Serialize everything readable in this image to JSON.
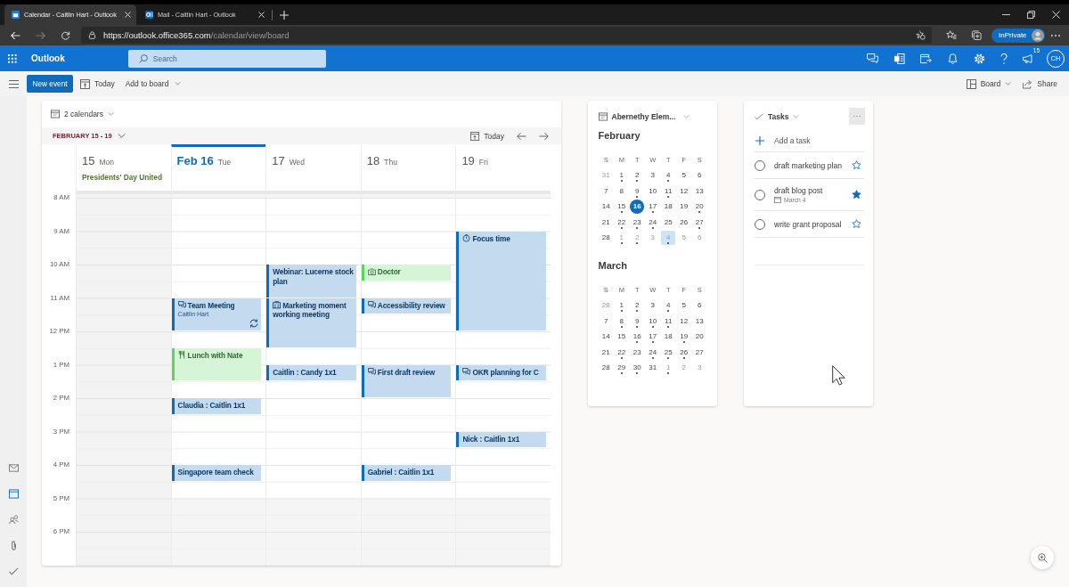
{
  "browser": {
    "tabs": [
      {
        "title": "Calendar - Caitlin Hart - Outlook",
        "selected": true
      },
      {
        "title": "Mail - Caitlin Hart - Outlook",
        "selected": false
      }
    ],
    "back_disabled": false,
    "forward_disabled": true,
    "address": {
      "url_main": "https://outlook.office365.com",
      "url_path": "/calendar/view/board"
    },
    "profile_label": "InPrivate"
  },
  "app_bar": {
    "app_name": "Outlook",
    "search": {
      "placeholder": "Search"
    },
    "notification_count": "15",
    "initials": "CH"
  },
  "command_bar": {
    "new_event": "New event",
    "today": "Today",
    "add_to_board": "Add to board",
    "view": "Board",
    "share": "Share"
  },
  "nav_rail": [
    {
      "selected": false
    },
    {
      "selected": true
    },
    {
      "selected": false
    },
    {
      "selected": false
    },
    {
      "selected": false
    }
  ],
  "calendar": {
    "calendars_label": "2 calendars",
    "date_range": "FEBRUARY 15 - 19",
    "today": "Today",
    "time_labels": [
      "8 AM",
      "9 AM",
      "10 AM",
      "11 AM",
      "12 PM",
      "1 PM",
      "2 PM",
      "3 PM",
      "4 PM",
      "5 PM",
      "6 PM"
    ],
    "days": [
      {
        "number": "15",
        "weekday": "Mon",
        "selected": false,
        "non_working": true,
        "all_day": "Presidents' Day United"
      },
      {
        "number": "Feb 16",
        "weekday": "Tue",
        "selected": true,
        "non_working": false,
        "slots": [
          {
            "kind": "free"
          },
          {
            "kind": "free"
          },
          {
            "kind": "free"
          },
          {
            "kind": "free"
          },
          {
            "kind": "free"
          },
          {
            "kind": "free"
          },
          {
            "kind": "event",
            "event": {
              "title": "Team Meeting",
              "detail": "Caitlin Hart",
              "color": "#0f6cbd",
              "kind": "online_meeting",
              "recurring": true
            }
          },
          {
            "kind": "continued"
          },
          {
            "kind": "free"
          },
          {
            "kind": "event",
            "event": {
              "title": "Lunch with Nate",
              "color": "#5ad65a",
              "kind": "meal",
              "recurring": false
            }
          },
          {
            "kind": "continued"
          },
          {
            "kind": "free"
          },
          {
            "kind": "event",
            "event": {
              "title": "Claudia : Caitlin 1x1",
              "color": "#0f6cbd",
              "kind": "plain",
              "recurring": false
            }
          },
          {
            "kind": "free"
          },
          {
            "kind": "free"
          },
          {
            "kind": "free"
          },
          {
            "kind": "event",
            "event": {
              "title": "Singapore team check",
              "color": "#0f6cbd",
              "kind": "plain",
              "recurring": false
            }
          }
        ]
      },
      {
        "number": "17",
        "weekday": "Wed",
        "selected": false,
        "non_working": false,
        "slots": [
          {
            "kind": "free"
          },
          {
            "kind": "free"
          },
          {
            "kind": "free"
          },
          {
            "kind": "free"
          },
          {
            "kind": "event",
            "event": {
              "title": "Webinar: Lucerne stock plan",
              "color": "#0f6cbd",
              "kind": "plain",
              "recurring": false
            }
          },
          {
            "kind": "continued"
          },
          {
            "kind": "event",
            "event": {
              "title": "Marketing moment working meeting",
              "color": "#0f6cbd",
              "kind": "room",
              "recurring": false
            }
          },
          {
            "kind": "continued"
          },
          {
            "kind": "continued"
          },
          {
            "kind": "free"
          },
          {
            "kind": "event",
            "event": {
              "title": "Caitlin : Candy 1x1",
              "color": "#0f6cbd",
              "kind": "plain",
              "recurring": false
            }
          }
        ]
      },
      {
        "number": "18",
        "weekday": "Thu",
        "selected": false,
        "non_working": false,
        "slots": [
          {
            "kind": "free"
          },
          {
            "kind": "free"
          },
          {
            "kind": "free"
          },
          {
            "kind": "free"
          },
          {
            "kind": "event",
            "event": {
              "title": "Doctor",
              "color": "#5ad65a",
              "kind": "appointment",
              "recurring": false
            }
          },
          {
            "kind": "free"
          },
          {
            "kind": "event",
            "event": {
              "title": "Accessibility review",
              "color": "#0f6cbd",
              "kind": "online_meeting",
              "recurring": false
            }
          },
          {
            "kind": "free"
          },
          {
            "kind": "free"
          },
          {
            "kind": "free"
          },
          {
            "kind": "event",
            "event": {
              "title": "First draft review",
              "color": "#0f6cbd",
              "kind": "online_meeting",
              "recurring": false
            }
          },
          {
            "kind": "continued"
          },
          {
            "kind": "free"
          },
          {
            "kind": "free"
          },
          {
            "kind": "free"
          },
          {
            "kind": "free"
          },
          {
            "kind": "event",
            "event": {
              "title": "Gabriel : Caitlin 1x1",
              "color": "#0f6cbd",
              "kind": "plain",
              "recurring": false
            }
          }
        ]
      },
      {
        "number": "19",
        "weekday": "Fri",
        "selected": false,
        "non_working": false,
        "slots": [
          {
            "kind": "free"
          },
          {
            "kind": "free"
          },
          {
            "kind": "event",
            "event": {
              "title": "Focus time",
              "color": "#0f6cbd",
              "kind": "focus",
              "recurring": false
            }
          },
          {
            "kind": "continued"
          },
          {
            "kind": "continued"
          },
          {
            "kind": "continued"
          },
          {
            "kind": "continued"
          },
          {
            "kind": "continued"
          },
          {
            "kind": "free"
          },
          {
            "kind": "free"
          },
          {
            "kind": "event",
            "event": {
              "title": "OKR planning for C",
              "color": "#0f6cbd",
              "kind": "online_meeting",
              "recurring": false
            }
          },
          {
            "kind": "free"
          },
          {
            "kind": "free"
          },
          {
            "kind": "free"
          },
          {
            "kind": "event",
            "event": {
              "title": "Nick : Caitlin 1x1",
              "color": "#0f6cbd",
              "kind": "plain",
              "recurring": false
            }
          }
        ]
      }
    ]
  },
  "mini_calendar": {
    "title": "Abernethy Elem...",
    "months": [
      {
        "name": "February",
        "weekdays": [
          "S",
          "M",
          "T",
          "W",
          "T",
          "F",
          "S"
        ],
        "weeks": [
          [
            {
              "label": "31",
              "outside_month": true,
              "events": false,
              "today": false,
              "selected": false
            },
            {
              "label": "1",
              "outside_month": false,
              "events": true,
              "today": false,
              "selected": false
            },
            {
              "label": "2",
              "outside_month": false,
              "events": true,
              "today": false,
              "selected": false
            },
            {
              "label": "3",
              "outside_month": false,
              "events": false,
              "today": false,
              "selected": false
            },
            {
              "label": "4",
              "outside_month": false,
              "events": true,
              "today": false,
              "selected": false
            },
            {
              "label": "5",
              "outside_month": false,
              "events": false,
              "today": false,
              "selected": false
            },
            {
              "label": "6",
              "outside_month": false,
              "events": false,
              "today": false,
              "selected": false
            }
          ],
          [
            {
              "label": "7",
              "outside_month": false,
              "events": false,
              "today": false,
              "selected": false
            },
            {
              "label": "8",
              "outside_month": false,
              "events": false,
              "today": false,
              "selected": false
            },
            {
              "label": "9",
              "outside_month": false,
              "events": true,
              "today": false,
              "selected": false
            },
            {
              "label": "10",
              "outside_month": false,
              "events": false,
              "today": false,
              "selected": false
            },
            {
              "label": "11",
              "outside_month": false,
              "events": true,
              "today": false,
              "selected": false
            },
            {
              "label": "12",
              "outside_month": false,
              "events": false,
              "today": false,
              "selected": false
            },
            {
              "label": "13",
              "outside_month": false,
              "events": false,
              "today": false,
              "selected": false
            }
          ],
          [
            {
              "label": "14",
              "outside_month": false,
              "events": false,
              "today": false,
              "selected": false
            },
            {
              "label": "15",
              "outside_month": false,
              "events": true,
              "today": false,
              "selected": false
            },
            {
              "label": "16",
              "outside_month": false,
              "events": false,
              "today": true,
              "selected": false
            },
            {
              "label": "17",
              "outside_month": false,
              "events": true,
              "today": false,
              "selected": false
            },
            {
              "label": "18",
              "outside_month": false,
              "events": false,
              "today": false,
              "selected": false
            },
            {
              "label": "19",
              "outside_month": false,
              "events": false,
              "today": false,
              "selected": false
            },
            {
              "label": "20",
              "outside_month": false,
              "events": true,
              "today": false,
              "selected": false
            }
          ],
          [
            {
              "label": "21",
              "outside_month": false,
              "events": false,
              "today": false,
              "selected": false
            },
            {
              "label": "22",
              "outside_month": false,
              "events": true,
              "today": false,
              "selected": false
            },
            {
              "label": "23",
              "outside_month": false,
              "events": true,
              "today": false,
              "selected": false
            },
            {
              "label": "24",
              "outside_month": false,
              "events": true,
              "today": false,
              "selected": false
            },
            {
              "label": "25",
              "outside_month": false,
              "events": false,
              "today": false,
              "selected": false
            },
            {
              "label": "26",
              "outside_month": false,
              "events": false,
              "today": false,
              "selected": false
            },
            {
              "label": "27",
              "outside_month": false,
              "events": true,
              "today": false,
              "selected": false
            }
          ],
          [
            {
              "label": "28",
              "outside_month": false,
              "events": false,
              "today": false,
              "selected": false
            },
            {
              "label": "1",
              "outside_month": true,
              "events": true,
              "today": false,
              "selected": false
            },
            {
              "label": "2",
              "outside_month": true,
              "events": true,
              "today": false,
              "selected": false
            },
            {
              "label": "3",
              "outside_month": true,
              "events": false,
              "today": false,
              "selected": false
            },
            {
              "label": "4",
              "outside_month": true,
              "events": true,
              "today": false,
              "selected": true
            },
            {
              "label": "5",
              "outside_month": true,
              "events": false,
              "today": false,
              "selected": false
            },
            {
              "label": "6",
              "outside_month": true,
              "events": false,
              "today": false,
              "selected": false
            }
          ]
        ]
      },
      {
        "name": "March",
        "weekdays": [
          "S",
          "M",
          "T",
          "W",
          "T",
          "F",
          "S"
        ],
        "weeks": [
          [
            {
              "label": "28",
              "outside_month": true,
              "events": false,
              "today": false,
              "selected": false
            },
            {
              "label": "1",
              "outside_month": false,
              "events": true,
              "today": false,
              "selected": false
            },
            {
              "label": "2",
              "outside_month": false,
              "events": true,
              "today": false,
              "selected": false
            },
            {
              "label": "3",
              "outside_month": false,
              "events": false,
              "today": false,
              "selected": false
            },
            {
              "label": "4",
              "outside_month": false,
              "events": true,
              "today": false,
              "selected": false
            },
            {
              "label": "5",
              "outside_month": false,
              "events": false,
              "today": false,
              "selected": false
            },
            {
              "label": "6",
              "outside_month": false,
              "events": false,
              "today": false,
              "selected": false
            }
          ],
          [
            {
              "label": "7",
              "outside_month": false,
              "events": false,
              "today": false,
              "selected": false
            },
            {
              "label": "8",
              "outside_month": false,
              "events": true,
              "today": false,
              "selected": false
            },
            {
              "label": "9",
              "outside_month": false,
              "events": true,
              "today": false,
              "selected": false
            },
            {
              "label": "10",
              "outside_month": false,
              "events": true,
              "today": false,
              "selected": false
            },
            {
              "label": "11",
              "outside_month": false,
              "events": true,
              "today": false,
              "selected": false
            },
            {
              "label": "12",
              "outside_month": false,
              "events": false,
              "today": false,
              "selected": false
            },
            {
              "label": "13",
              "outside_month": false,
              "events": false,
              "today": false,
              "selected": false
            }
          ],
          [
            {
              "label": "14",
              "outside_month": false,
              "events": false,
              "today": false,
              "selected": false
            },
            {
              "label": "15",
              "outside_month": false,
              "events": false,
              "today": false,
              "selected": false
            },
            {
              "label": "16",
              "outside_month": false,
              "events": true,
              "today": false,
              "selected": false
            },
            {
              "label": "17",
              "outside_month": false,
              "events": true,
              "today": false,
              "selected": false
            },
            {
              "label": "18",
              "outside_month": false,
              "events": false,
              "today": false,
              "selected": false
            },
            {
              "label": "19",
              "outside_month": false,
              "events": true,
              "today": false,
              "selected": false
            },
            {
              "label": "20",
              "outside_month": false,
              "events": false,
              "today": false,
              "selected": false
            }
          ],
          [
            {
              "label": "21",
              "outside_month": false,
              "events": false,
              "today": false,
              "selected": false
            },
            {
              "label": "22",
              "outside_month": false,
              "events": true,
              "today": false,
              "selected": false
            },
            {
              "label": "23",
              "outside_month": false,
              "events": false,
              "today": false,
              "selected": false
            },
            {
              "label": "24",
              "outside_month": false,
              "events": true,
              "today": false,
              "selected": false
            },
            {
              "label": "25",
              "outside_month": false,
              "events": true,
              "today": false,
              "selected": false
            },
            {
              "label": "26",
              "outside_month": false,
              "events": true,
              "today": false,
              "selected": false
            },
            {
              "label": "27",
              "outside_month": false,
              "events": false,
              "today": false,
              "selected": false
            }
          ],
          [
            {
              "label": "28",
              "outside_month": false,
              "events": false,
              "today": false,
              "selected": false
            },
            {
              "label": "29",
              "outside_month": false,
              "events": true,
              "today": false,
              "selected": false
            },
            {
              "label": "30",
              "outside_month": false,
              "events": true,
              "today": false,
              "selected": false
            },
            {
              "label": "31",
              "outside_month": false,
              "events": false,
              "today": false,
              "selected": false
            },
            {
              "label": "1",
              "outside_month": true,
              "events": true,
              "today": false,
              "selected": false
            },
            {
              "label": "2",
              "outside_month": true,
              "events": false,
              "today": false,
              "selected": false
            },
            {
              "label": "3",
              "outside_month": true,
              "events": false,
              "today": false,
              "selected": false
            }
          ]
        ]
      }
    ]
  },
  "tasks": {
    "title": "Tasks",
    "add_label": "Add a task",
    "items": [
      {
        "title": "draft marketing plan",
        "completed": false,
        "important": false
      },
      {
        "title": "draft blog post",
        "due": "March 4",
        "completed": false,
        "important": true
      },
      {
        "title": "write grant proposal",
        "completed": false,
        "important": false
      }
    ]
  }
}
